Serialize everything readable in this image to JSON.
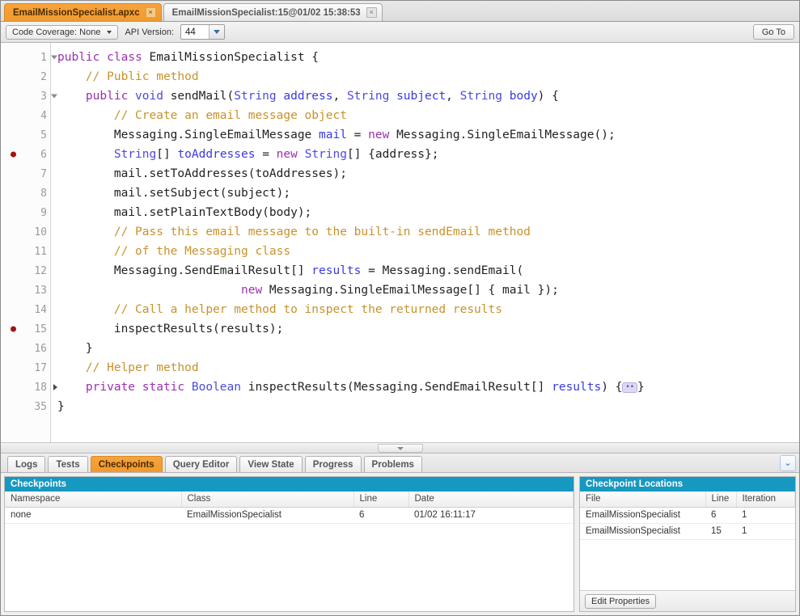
{
  "tabs": [
    {
      "label": "EmailMissionSpecialist.apxc",
      "active": true,
      "close": "×"
    },
    {
      "label": "EmailMissionSpecialist:15@01/02 15:38:53",
      "active": false,
      "close": "×"
    }
  ],
  "toolbar": {
    "code_coverage_label": "Code Coverage: None",
    "api_version_label": "API Version:",
    "api_version_value": "44",
    "goto_label": "Go To"
  },
  "editor": {
    "lines": [
      {
        "num": "1",
        "breakpoint": false,
        "fold": "open",
        "indent": 0,
        "tokens": [
          {
            "t": "public ",
            "c": "mod"
          },
          {
            "t": "class ",
            "c": "mod"
          },
          {
            "t": "EmailMissionSpecialist {",
            "c": "pl"
          }
        ]
      },
      {
        "num": "2",
        "breakpoint": false,
        "fold": "",
        "indent": 1,
        "tokens": [
          {
            "t": "// Public method",
            "c": "cmt"
          }
        ]
      },
      {
        "num": "3",
        "breakpoint": false,
        "fold": "open",
        "indent": 1,
        "tokens": [
          {
            "t": "public ",
            "c": "mod"
          },
          {
            "t": "void ",
            "c": "type"
          },
          {
            "t": "sendMail(",
            "c": "pl"
          },
          {
            "t": "String ",
            "c": "type"
          },
          {
            "t": "address",
            "c": "var"
          },
          {
            "t": ", ",
            "c": "pl"
          },
          {
            "t": "String ",
            "c": "type"
          },
          {
            "t": "subject",
            "c": "var"
          },
          {
            "t": ", ",
            "c": "pl"
          },
          {
            "t": "String ",
            "c": "type"
          },
          {
            "t": "body",
            "c": "var"
          },
          {
            "t": ") {",
            "c": "pl"
          }
        ]
      },
      {
        "num": "4",
        "breakpoint": false,
        "fold": "",
        "indent": 2,
        "tokens": [
          {
            "t": "// Create an email message object",
            "c": "cmt"
          }
        ]
      },
      {
        "num": "5",
        "breakpoint": false,
        "fold": "",
        "indent": 2,
        "tokens": [
          {
            "t": "Messaging.SingleEmailMessage ",
            "c": "pl"
          },
          {
            "t": "mail ",
            "c": "var"
          },
          {
            "t": "= ",
            "c": "pl"
          },
          {
            "t": "new ",
            "c": "mod"
          },
          {
            "t": "Messaging.SingleEmailMessage();",
            "c": "pl"
          }
        ]
      },
      {
        "num": "6",
        "breakpoint": true,
        "fold": "",
        "indent": 2,
        "tokens": [
          {
            "t": "String",
            "c": "type"
          },
          {
            "t": "[] ",
            "c": "pl"
          },
          {
            "t": "toAddresses ",
            "c": "var"
          },
          {
            "t": "= ",
            "c": "pl"
          },
          {
            "t": "new ",
            "c": "mod"
          },
          {
            "t": "String",
            "c": "type"
          },
          {
            "t": "[] {address};",
            "c": "pl"
          }
        ]
      },
      {
        "num": "7",
        "breakpoint": false,
        "fold": "",
        "indent": 2,
        "tokens": [
          {
            "t": "mail.setToAddresses(toAddresses);",
            "c": "pl"
          }
        ]
      },
      {
        "num": "8",
        "breakpoint": false,
        "fold": "",
        "indent": 2,
        "tokens": [
          {
            "t": "mail.setSubject(subject);",
            "c": "pl"
          }
        ]
      },
      {
        "num": "9",
        "breakpoint": false,
        "fold": "",
        "indent": 2,
        "tokens": [
          {
            "t": "mail.setPlainTextBody(body);",
            "c": "pl"
          }
        ]
      },
      {
        "num": "10",
        "breakpoint": false,
        "fold": "",
        "indent": 2,
        "tokens": [
          {
            "t": "// Pass this email message to the built-in sendEmail method",
            "c": "cmt"
          }
        ]
      },
      {
        "num": "11",
        "breakpoint": false,
        "fold": "",
        "indent": 2,
        "tokens": [
          {
            "t": "// of the Messaging class",
            "c": "cmt"
          }
        ]
      },
      {
        "num": "12",
        "breakpoint": false,
        "fold": "",
        "indent": 2,
        "tokens": [
          {
            "t": "Messaging.SendEmailResult[] ",
            "c": "pl"
          },
          {
            "t": "results ",
            "c": "var"
          },
          {
            "t": "= Messaging.sendEmail(",
            "c": "pl"
          }
        ]
      },
      {
        "num": "13",
        "breakpoint": false,
        "fold": "",
        "indent": 2,
        "tokens": [
          {
            "t": "                  ",
            "c": "pl"
          },
          {
            "t": "new ",
            "c": "mod"
          },
          {
            "t": "Messaging.SingleEmailMessage[] { mail });",
            "c": "pl"
          }
        ]
      },
      {
        "num": "14",
        "breakpoint": false,
        "fold": "",
        "indent": 2,
        "tokens": [
          {
            "t": "// Call a helper method to inspect the returned results",
            "c": "cmt"
          }
        ]
      },
      {
        "num": "15",
        "breakpoint": true,
        "fold": "",
        "indent": 2,
        "tokens": [
          {
            "t": "inspectResults(results);",
            "c": "pl"
          }
        ]
      },
      {
        "num": "16",
        "breakpoint": false,
        "fold": "",
        "indent": 1,
        "tokens": [
          {
            "t": "}",
            "c": "pl"
          }
        ]
      },
      {
        "num": "17",
        "breakpoint": false,
        "fold": "",
        "indent": 1,
        "tokens": [
          {
            "t": "// Helper method",
            "c": "cmt"
          }
        ]
      },
      {
        "num": "18",
        "breakpoint": false,
        "fold": "closed",
        "indent": 1,
        "tokens": [
          {
            "t": "private ",
            "c": "mod"
          },
          {
            "t": "static ",
            "c": "mod"
          },
          {
            "t": "Boolean ",
            "c": "type"
          },
          {
            "t": "inspectResults(Messaging.SendEmailResult[] ",
            "c": "pl"
          },
          {
            "t": "results",
            "c": "var"
          },
          {
            "t": ") {",
            "c": "pl"
          },
          {
            "t": "FOLDGLYPH",
            "c": "fold"
          },
          {
            "t": "}",
            "c": "pl"
          }
        ]
      },
      {
        "num": "35",
        "breakpoint": false,
        "fold": "",
        "indent": 0,
        "tokens": [
          {
            "t": "}",
            "c": "pl"
          }
        ]
      }
    ],
    "fold_glyph": "••"
  },
  "bottom": {
    "tabs": [
      {
        "label": "Logs",
        "active": false
      },
      {
        "label": "Tests",
        "active": false
      },
      {
        "label": "Checkpoints",
        "active": true
      },
      {
        "label": "Query Editor",
        "active": false
      },
      {
        "label": "View State",
        "active": false
      },
      {
        "label": "Progress",
        "active": false
      },
      {
        "label": "Problems",
        "active": false
      }
    ],
    "expand_icon": "⌄⌄",
    "left_panel": {
      "title": "Checkpoints",
      "columns": [
        "Namespace",
        "Class",
        "Line",
        "Date"
      ],
      "rows": [
        [
          "none",
          "EmailMissionSpecialist",
          "6",
          "01/02 16:11:17"
        ]
      ]
    },
    "right_panel": {
      "title": "Checkpoint Locations",
      "columns": [
        "File",
        "Line",
        "Iteration"
      ],
      "rows": [
        [
          "EmailMissionSpecialist",
          "6",
          "1"
        ],
        [
          "EmailMissionSpecialist",
          "15",
          "1"
        ]
      ],
      "edit_properties_label": "Edit Properties"
    }
  },
  "colors": {
    "accent_orange": "#f7a33c",
    "panel_title_blue": "#1798c1",
    "breakpoint_red": "#a41111",
    "comment": "#c8922a",
    "modifier": "#9b30b0",
    "type": "#4a4ae0"
  }
}
